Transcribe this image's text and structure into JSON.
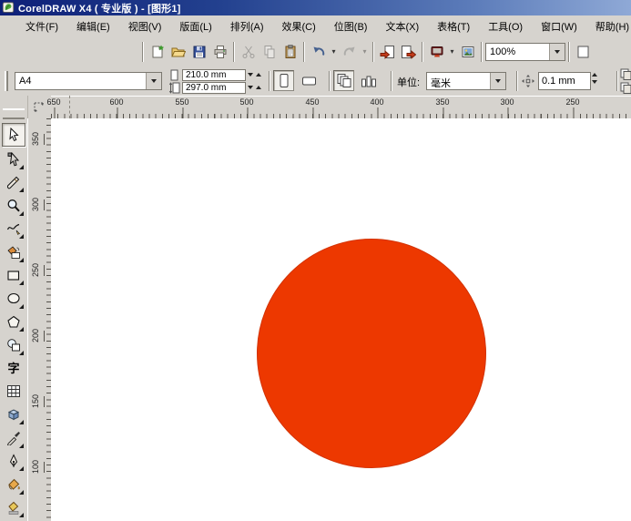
{
  "window": {
    "title": "CorelDRAW X4 ( 专业版 ) - [图形1]"
  },
  "menu": {
    "items": [
      "文件(F)",
      "编辑(E)",
      "视图(V)",
      "版面(L)",
      "排列(A)",
      "效果(C)",
      "位图(B)",
      "文本(X)",
      "表格(T)",
      "工具(O)",
      "窗口(W)",
      "帮助(H)"
    ]
  },
  "toolbar": {
    "zoom_level": "100%",
    "icons": [
      "new",
      "open",
      "save",
      "print",
      "cut",
      "copy",
      "paste",
      "undo",
      "redo",
      "import",
      "export",
      "application-launcher",
      "welcome-screen"
    ]
  },
  "property_bar": {
    "paper_type": "A4",
    "paper_width": "210.0 mm",
    "paper_height": "297.0 mm",
    "units_label": "单位:",
    "units_value": "毫米",
    "nudge_offset": "0.1 mm"
  },
  "rulers": {
    "horizontal_labels": [
      "650",
      "600",
      "550",
      "500",
      "450",
      "400",
      "350",
      "300",
      "250"
    ],
    "vertical_labels": [
      "350",
      "300",
      "250",
      "200",
      "150",
      "100"
    ]
  },
  "toolbox": {
    "text_tool_glyph": "字",
    "tools": [
      {
        "name": "pick-tool",
        "selected": true
      },
      {
        "name": "shape-tool"
      },
      {
        "name": "crop-tool"
      },
      {
        "name": "zoom-tool"
      },
      {
        "name": "freehand-tool"
      },
      {
        "name": "smart-fill-tool"
      },
      {
        "name": "rectangle-tool"
      },
      {
        "name": "ellipse-tool"
      },
      {
        "name": "polygon-tool"
      },
      {
        "name": "basic-shapes-tool"
      },
      {
        "name": "text-tool"
      },
      {
        "name": "table-tool"
      },
      {
        "name": "interactive-blend-tool"
      },
      {
        "name": "eyedropper-tool"
      },
      {
        "name": "outline-pen-tool"
      },
      {
        "name": "fill-tool"
      },
      {
        "name": "interactive-fill-tool"
      }
    ]
  },
  "canvas": {
    "circle": {
      "type": "ellipse",
      "fill": "#ed3800",
      "stroke": "#d33100"
    }
  },
  "colors": {
    "titlebar_start": "#0e1f78",
    "titlebar_end": "#8fa9d6",
    "chrome": "#d6d3ce",
    "page": "#ffffff"
  }
}
